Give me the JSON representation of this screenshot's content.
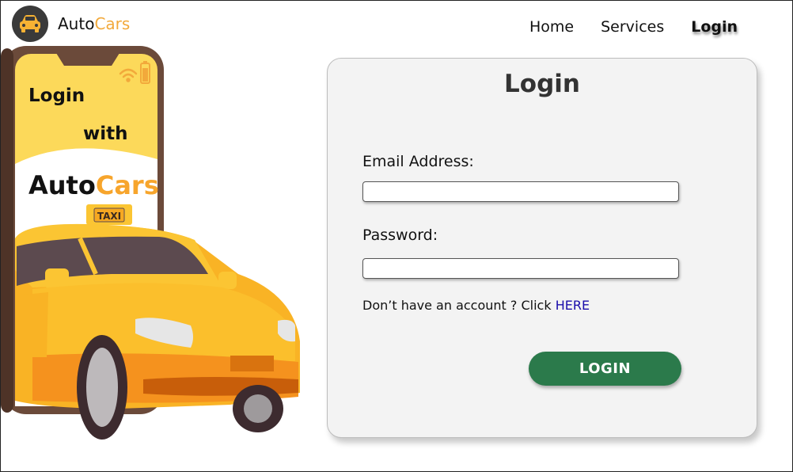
{
  "brand": {
    "name_part1": "Auto",
    "name_part2": "Cars",
    "icon": "car-icon"
  },
  "nav": {
    "items": [
      "Home",
      "Services",
      "Login"
    ],
    "active": "Login"
  },
  "illustration": {
    "line1": "Login",
    "line2": "with",
    "brand_part1": "Auto",
    "brand_part2": "Cars",
    "taxi_sign": "TAXI"
  },
  "login_card": {
    "title": "Login",
    "email_label": "Email Address:",
    "email_value": "",
    "password_label": "Password:",
    "password_value": "",
    "signup_prompt": "Don’t have an account ? Click ",
    "signup_link": "HERE",
    "submit_label": "LOGIN"
  },
  "colors": {
    "accent_orange": "#f2a93b",
    "button_green": "#2b7a4b",
    "link_blue": "#1a0dab",
    "card_bg": "#f3f3f3",
    "phone_screen_yellow": "#fcd95a"
  }
}
